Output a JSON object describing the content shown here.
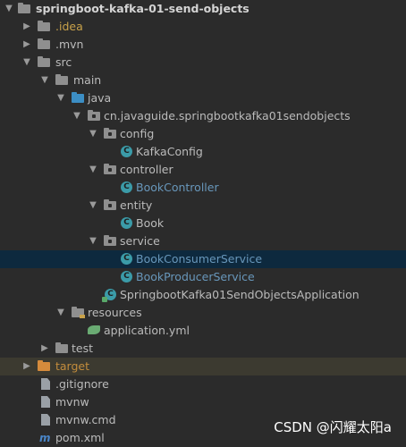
{
  "project": {
    "root_label": "springboot-kafka-01-send-objects"
  },
  "tree": {
    "idea": ".idea",
    "mvn": ".mvn",
    "src": "src",
    "main": "main",
    "java": "java",
    "package": "cn.javaguide.springbootkafka01sendobjects",
    "config": "config",
    "kafka_config": "KafkaConfig",
    "controller": "controller",
    "book_controller": "BookController",
    "entity": "entity",
    "book": "Book",
    "service": "service",
    "book_consumer_service": "BookConsumerService",
    "book_producer_service": "BookProducerService",
    "application_class": "SpringbootKafka01SendObjectsApplication",
    "resources": "resources",
    "application_yml": "application.yml",
    "test": "test",
    "target": "target",
    "gitignore": ".gitignore",
    "mvnw": "mvnw",
    "mvnw_cmd": "mvnw.cmd",
    "pom": "pom.xml"
  },
  "class_icon_letter": "C",
  "maven_icon_letter": "m",
  "watermark": "CSDN @闪耀太阳a",
  "colors": {
    "background": "#2b2b2b",
    "selected_row": "#0d293e",
    "excluded_row": "#3c3a30",
    "modified_text": "#6897bb",
    "excluded_text": "#c38c3c",
    "idea_text": "#c9a24a"
  }
}
